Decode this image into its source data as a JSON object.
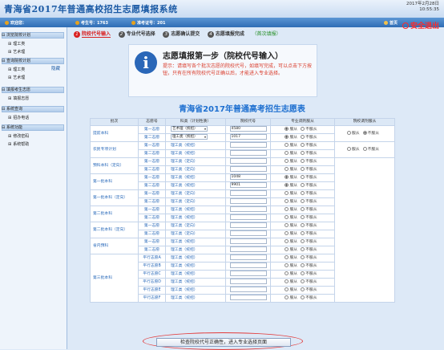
{
  "header": {
    "title": "青海省2017年普通高校招生志愿填报系统",
    "date": "2017年2月28日",
    "time": "10:55:35"
  },
  "userbar": {
    "welcome": "欢迎您：",
    "examinee_no": "考生号：1763",
    "admission_no": "准考证号：201",
    "home": "首页",
    "exit": "安全退出"
  },
  "sidebar": {
    "hide_label": "隐藏",
    "groups": [
      {
        "title": "浏览院校计划",
        "items": [
          "理工类",
          "艺术理"
        ]
      },
      {
        "title": "查询院校计划",
        "items": [
          "理工类",
          "艺术理"
        ]
      },
      {
        "title": "填报考生志愿",
        "items": [
          "填报志愿"
        ]
      },
      {
        "title": "系统查询",
        "items": [
          "招办电话"
        ]
      },
      {
        "title": "系统功能",
        "items": [
          "修改密码",
          "系统帮助"
        ]
      }
    ]
  },
  "steps": [
    {
      "num": "1",
      "label": "院校代号输入"
    },
    {
      "num": "2",
      "label": "专业代号选择"
    },
    {
      "num": "3",
      "label": "志愿确认提交"
    },
    {
      "num": "4",
      "label": "志愿填报完成"
    },
    {
      "num": "",
      "label": "（首次填报）"
    }
  ],
  "notice": {
    "heading": "志愿填报第一步（院校代号输入）",
    "text": "提示：请填写各个批次志愿的院校代号，如填写完成，可以点击下方按钮，只有在所有院校代号正确以后，才能进入专业选择。"
  },
  "form_title": "青海省2017年普通高考招生志愿表",
  "table": {
    "headers": [
      "批次",
      "志愿号",
      "科类（计划性质）",
      "院校代号",
      "专业调剂服从",
      "院校调剂服从"
    ],
    "radio_yes": "服从",
    "radio_no": "不服从",
    "rows": [
      {
        "batch": "提前本科",
        "vol": "第一志愿",
        "subject": "艺术理（统招）",
        "subject_type": "select",
        "code": "4580",
        "major_obey": "yes",
        "school": "no"
      },
      {
        "batch": "",
        "vol": "第二志愿",
        "subject": "理工类（统招）",
        "subject_type": "select",
        "code": "1017",
        "major_obey": "yes",
        "school": ""
      },
      {
        "batch": "农民专项计划",
        "vol": "第一志愿",
        "subject": "理工类（统招）",
        "subject_type": "text",
        "code": "",
        "major_obey": "none",
        "school": "none"
      },
      {
        "batch": "",
        "vol": "第二志愿",
        "subject": "理工类（统招）",
        "subject_type": "text",
        "code": "",
        "major_obey": "none",
        "school": ""
      },
      {
        "batch": "预科本科（定向）",
        "vol": "第一志愿",
        "subject": "理工类（定向）",
        "subject_type": "text",
        "code": "",
        "major_obey": "none",
        "school": ""
      },
      {
        "batch": "",
        "vol": "第二志愿",
        "subject": "理工类（定向）",
        "subject_type": "text",
        "code": "",
        "major_obey": "none",
        "school": ""
      },
      {
        "batch": "第一批本科",
        "vol": "第一志愿",
        "subject": "理工类（统招）",
        "subject_type": "text",
        "code": "1048",
        "major_obey": "yes",
        "school": ""
      },
      {
        "batch": "",
        "vol": "第二志愿",
        "subject": "理工类（统招）",
        "subject_type": "text",
        "code": "9901",
        "major_obey": "yes",
        "school": ""
      },
      {
        "batch": "第一批本科（定向）",
        "vol": "第一志愿",
        "subject": "理工类（定向）",
        "subject_type": "text",
        "code": "",
        "major_obey": "none",
        "school": ""
      },
      {
        "batch": "",
        "vol": "第二志愿",
        "subject": "理工类（定向）",
        "subject_type": "text",
        "code": "",
        "major_obey": "none",
        "school": ""
      },
      {
        "batch": "第二批本科",
        "vol": "第一志愿",
        "subject": "理工类（统招）",
        "subject_type": "text",
        "code": "",
        "major_obey": "none",
        "school": ""
      },
      {
        "batch": "",
        "vol": "第二志愿",
        "subject": "理工类（统招）",
        "subject_type": "text",
        "code": "",
        "major_obey": "none",
        "school": ""
      },
      {
        "batch": "第二批本科（定向）",
        "vol": "第一志愿",
        "subject": "理工类（定向）",
        "subject_type": "text",
        "code": "",
        "major_obey": "none",
        "school": ""
      },
      {
        "batch": "",
        "vol": "第二志愿",
        "subject": "理工类（定向）",
        "subject_type": "text",
        "code": "",
        "major_obey": "none",
        "school": ""
      },
      {
        "batch": "省内预科",
        "vol": "第一志愿",
        "subject": "理工类（统招）",
        "subject_type": "text",
        "code": "",
        "major_obey": "none",
        "school": ""
      },
      {
        "batch": "",
        "vol": "第二志愿",
        "subject": "理工类（统招）",
        "subject_type": "text",
        "code": "",
        "major_obey": "none",
        "school": ""
      },
      {
        "batch": "第三批本科",
        "vol": "平行志愿A",
        "subject": "理工类（统招）",
        "subject_type": "text",
        "code": "",
        "major_obey": "none",
        "school": ""
      },
      {
        "batch": "",
        "vol": "平行志愿B",
        "subject": "理工类（统招）",
        "subject_type": "text",
        "code": "",
        "major_obey": "none",
        "school": ""
      },
      {
        "batch": "",
        "vol": "平行志愿C",
        "subject": "理工类（统招）",
        "subject_type": "text",
        "code": "",
        "major_obey": "none",
        "school": ""
      },
      {
        "batch": "",
        "vol": "平行志愿D",
        "subject": "理工类（统招）",
        "subject_type": "text",
        "code": "",
        "major_obey": "none",
        "school": ""
      },
      {
        "batch": "",
        "vol": "平行志愿E",
        "subject": "理工类（统招）",
        "subject_type": "text",
        "code": "",
        "major_obey": "none",
        "school": ""
      },
      {
        "batch": "",
        "vol": "平行志愿F",
        "subject": "理工类（统招）",
        "subject_type": "text",
        "code": "",
        "major_obey": "none",
        "school": ""
      }
    ]
  },
  "submit_label": "检查院校代号正确性，进入专业选择页面"
}
